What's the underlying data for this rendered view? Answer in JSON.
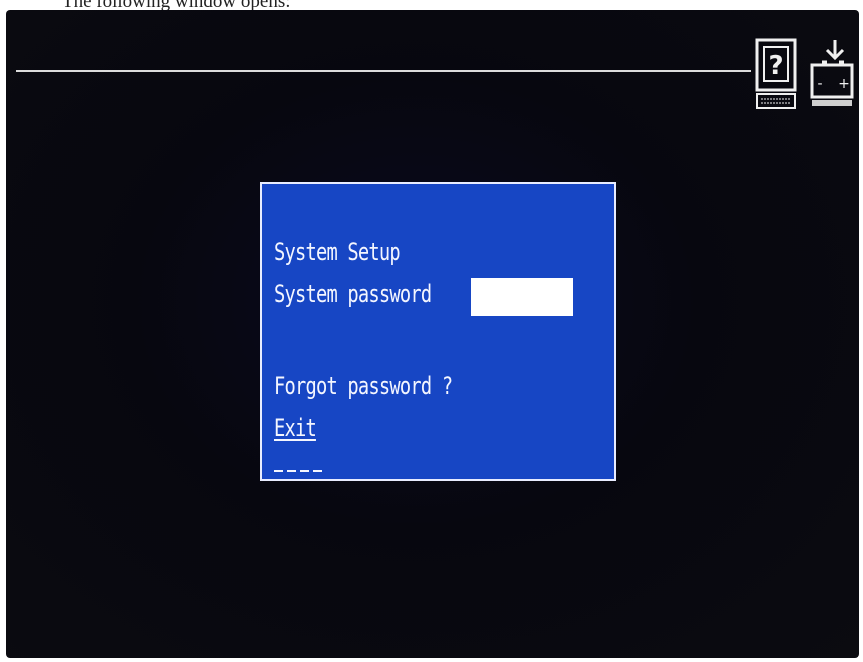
{
  "top_strip": {
    "caption": "The following window opens:"
  },
  "toolbar": {
    "help_icon": "help-computer-icon",
    "battery_icon": "battery-icon",
    "battery_minus": "-",
    "battery_plus": "+",
    "help_glyph": "?"
  },
  "dialog": {
    "title": "System Setup",
    "password_label": "System password",
    "password_value": "",
    "forgot_label": "Forgot password ?",
    "exit_label": "Exit"
  },
  "colors": {
    "dialog_bg": "#1746c4",
    "screen_bg": "#07070f",
    "text": "#f4f6ff"
  }
}
